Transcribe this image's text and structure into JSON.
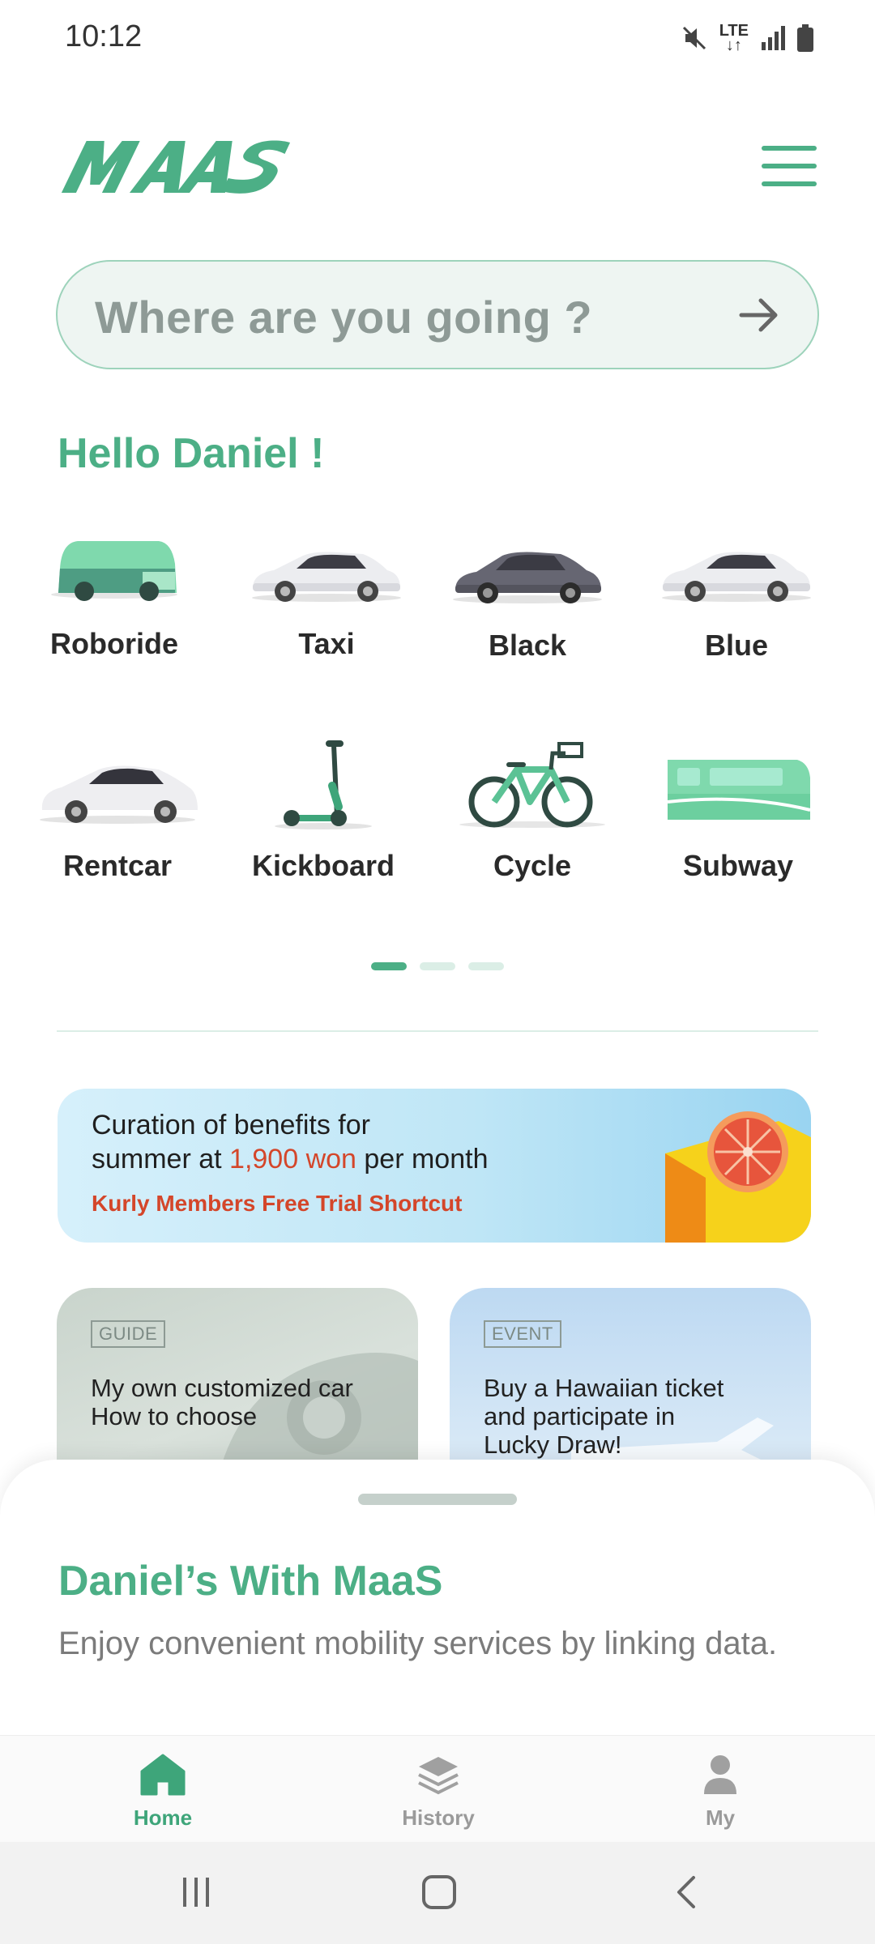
{
  "status_bar": {
    "time": "10:12",
    "network": "LTE",
    "icons": [
      "mute-icon",
      "lte-icon",
      "signal-icon",
      "battery-icon"
    ]
  },
  "header": {
    "logo_text": "MAAS",
    "menu_icon": "hamburger-menu-icon"
  },
  "search": {
    "placeholder": "Where are you going ?",
    "icon": "arrow-right-icon"
  },
  "greeting": "Hello Daniel !",
  "services": [
    {
      "label": "Roboride",
      "icon": "roboride-vehicle-icon"
    },
    {
      "label": "Taxi",
      "icon": "taxi-car-icon"
    },
    {
      "label": "Black",
      "icon": "black-car-icon"
    },
    {
      "label": "Blue",
      "icon": "blue-car-icon"
    },
    {
      "label": "Rentcar",
      "icon": "rentcar-icon"
    },
    {
      "label": "Kickboard",
      "icon": "kickboard-icon"
    },
    {
      "label": "Cycle",
      "icon": "bicycle-icon"
    },
    {
      "label": "Subway",
      "icon": "subway-train-icon"
    }
  ],
  "pagination": {
    "pages": 3,
    "current": 1
  },
  "banner": {
    "line1": "Curation of benefits for",
    "line2_before": "summer at ",
    "line2_highlight": "1,900 won",
    "line2_after": " per month",
    "link": "Kurly Members Free Trial Shortcut"
  },
  "cards": [
    {
      "tag": "GUIDE",
      "title_line1": "My own customized car",
      "title_line2": "How to choose"
    },
    {
      "tag": "EVENT",
      "title_line1": "Buy a Hawaiian ticket",
      "title_line2": "and participate in",
      "title_line3": "Lucky Draw!"
    }
  ],
  "sheet": {
    "title": "Daniel’s With MaaS",
    "subtitle": "Enjoy convenient mobility services by linking data."
  },
  "bottom_nav": [
    {
      "label": "Home",
      "icon": "home-icon",
      "active": true
    },
    {
      "label": "History",
      "icon": "layers-icon",
      "active": false
    },
    {
      "label": "My",
      "icon": "user-icon",
      "active": false
    }
  ],
  "colors": {
    "accent": "#4caf86",
    "highlight": "#d4462a",
    "inactive": "#9a9a9a"
  }
}
